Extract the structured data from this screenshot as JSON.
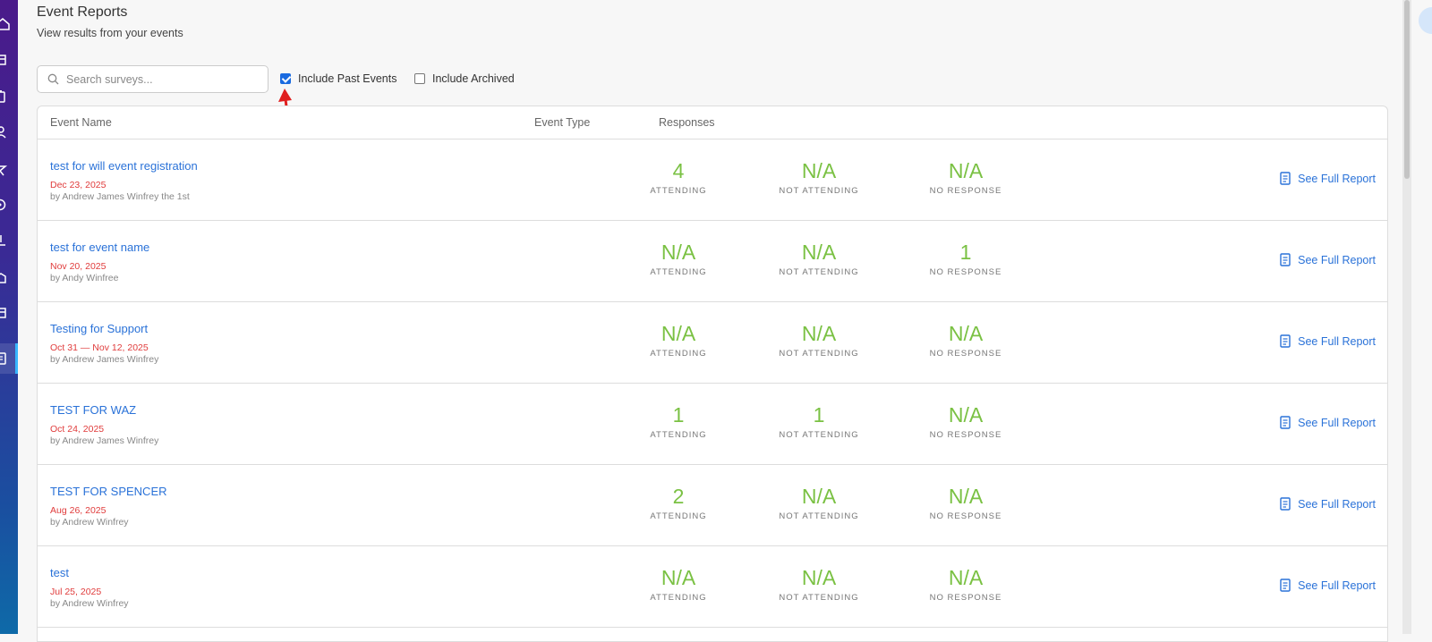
{
  "header": {
    "title": "Event Reports",
    "subtitle": "View results from your events"
  },
  "search": {
    "placeholder": "Search surveys...",
    "value": ""
  },
  "filters": {
    "include_past_label": "Include Past Events",
    "include_past_checked": true,
    "include_archived_label": "Include Archived",
    "include_archived_checked": false
  },
  "table": {
    "columns": [
      "Event Name",
      "Event Type",
      "Responses"
    ],
    "stat_labels": [
      "ATTENDING",
      "NOT ATTENDING",
      "NO RESPONSE"
    ],
    "rows": [
      {
        "name": "test for will event registration",
        "date": "Dec 23, 2025",
        "by": "by Andrew James Winfrey the 1st",
        "attending": "4",
        "not_attending": "N/A",
        "no_response": "N/A",
        "link": "See Full Report"
      },
      {
        "name": "test for event name",
        "date": "Nov 20, 2025",
        "by": "by Andy Winfree",
        "attending": "N/A",
        "not_attending": "N/A",
        "no_response": "1",
        "link": "See Full Report"
      },
      {
        "name": "Testing for Support",
        "date": "Oct 31 — Nov 12, 2025",
        "by": "by Andrew James Winfrey",
        "attending": "N/A",
        "not_attending": "N/A",
        "no_response": "N/A",
        "link": "See Full Report"
      },
      {
        "name": "TEST FOR WAZ",
        "date": "Oct 24, 2025",
        "by": "by Andrew James Winfrey",
        "attending": "1",
        "not_attending": "1",
        "no_response": "N/A",
        "link": "See Full Report"
      },
      {
        "name": "TEST FOR SPENCER",
        "date": "Aug 26, 2025",
        "by": "by Andrew Winfrey",
        "attending": "2",
        "not_attending": "N/A",
        "no_response": "N/A",
        "link": "See Full Report"
      },
      {
        "name": "test",
        "date": "Jul 25, 2025",
        "by": "by Andrew Winfrey",
        "attending": "N/A",
        "not_attending": "N/A",
        "no_response": "N/A",
        "link": "See Full Report"
      }
    ]
  },
  "colors": {
    "accent": "#2a72d8",
    "date": "#e03c3c",
    "stat": "#7ac143",
    "annotation_arrow": "#e02020"
  },
  "sidebar": {
    "icons": [
      "home-icon",
      "calendar-icon",
      "clipboard-icon",
      "users-icon",
      "star-icon",
      "help-icon",
      "download-icon",
      "folder-icon",
      "table-icon",
      "report-icon"
    ]
  }
}
